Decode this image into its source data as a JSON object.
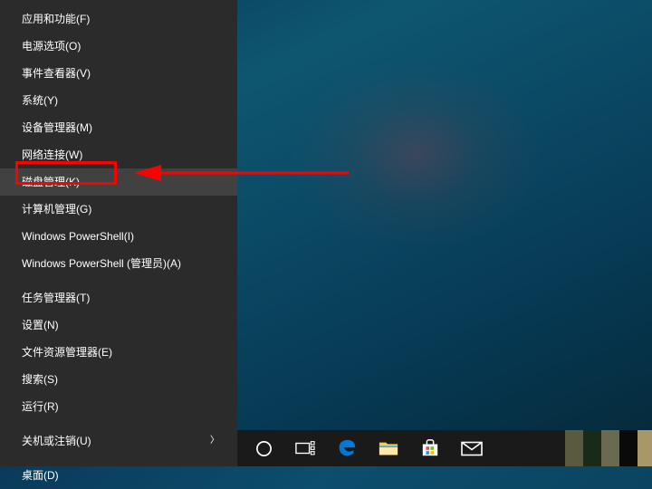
{
  "menu": {
    "sections": [
      [
        {
          "label": "应用和功能(F)",
          "hotkey": "F"
        },
        {
          "label": "电源选项(O)",
          "hotkey": "O"
        },
        {
          "label": "事件查看器(V)",
          "hotkey": "V"
        },
        {
          "label": "系统(Y)",
          "hotkey": "Y"
        },
        {
          "label": "设备管理器(M)",
          "hotkey": "M"
        },
        {
          "label": "网络连接(W)",
          "hotkey": "W"
        },
        {
          "label": "磁盘管理(K)",
          "hotkey": "K",
          "hovered": true,
          "highlighted": true
        },
        {
          "label": "计算机管理(G)",
          "hotkey": "G"
        },
        {
          "label": "Windows PowerShell(I)",
          "hotkey": "I"
        },
        {
          "label": "Windows PowerShell (管理员)(A)",
          "hotkey": "A"
        }
      ],
      [
        {
          "label": "任务管理器(T)",
          "hotkey": "T"
        },
        {
          "label": "设置(N)",
          "hotkey": "N"
        },
        {
          "label": "文件资源管理器(E)",
          "hotkey": "E"
        },
        {
          "label": "搜索(S)",
          "hotkey": "S"
        },
        {
          "label": "运行(R)",
          "hotkey": "R"
        }
      ],
      [
        {
          "label": "关机或注销(U)",
          "hotkey": "U",
          "submenu": true
        }
      ],
      [
        {
          "label": "桌面(D)",
          "hotkey": "D"
        }
      ]
    ]
  },
  "annotation": {
    "highlight_color": "#ff0000",
    "arrow_color": "#ff0000"
  },
  "taskbar": {
    "icons": [
      {
        "name": "cortana-circle"
      },
      {
        "name": "task-view"
      },
      {
        "name": "edge"
      },
      {
        "name": "file-explorer"
      },
      {
        "name": "microsoft-store"
      },
      {
        "name": "mail"
      }
    ]
  }
}
